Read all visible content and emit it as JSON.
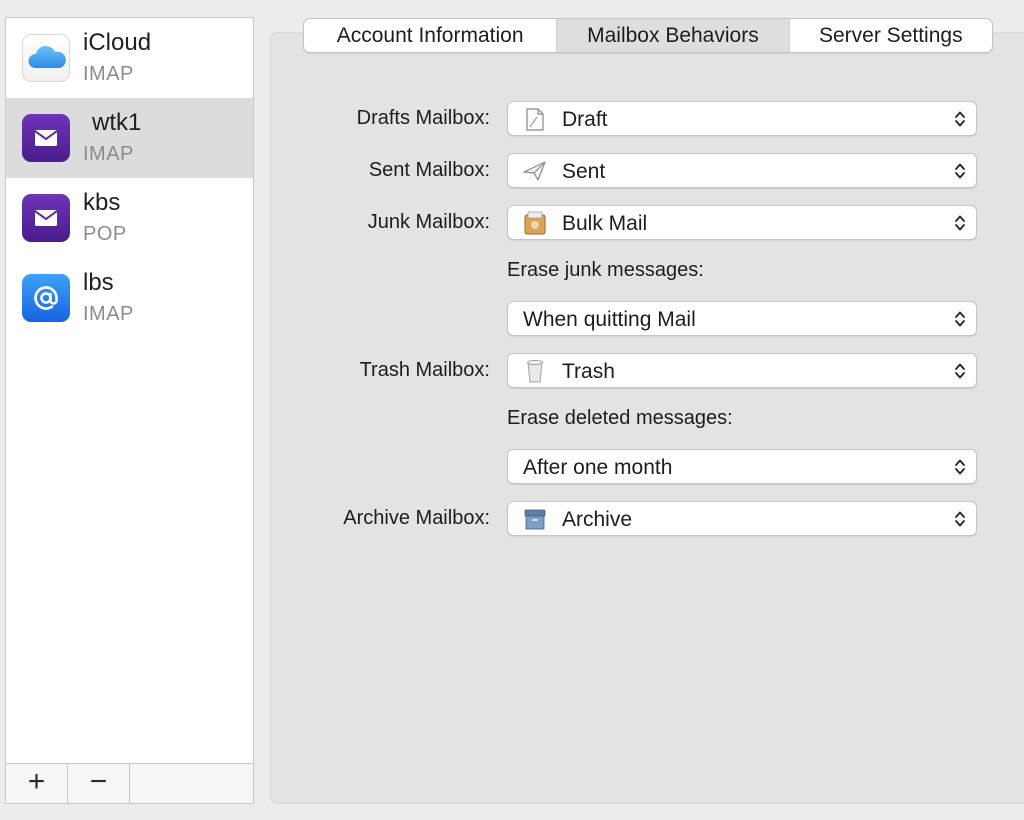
{
  "sidebar": {
    "accounts": [
      {
        "name": "iCloud",
        "type": "IMAP",
        "icon": "icloud-icon"
      },
      {
        "name": "wtk1",
        "type": "IMAP",
        "icon": "envelope-icon"
      },
      {
        "name": "kbs",
        "type": "POP",
        "icon": "envelope-icon"
      },
      {
        "name": "lbs",
        "type": "IMAP",
        "icon": "at-sign-icon"
      }
    ],
    "selected_index": 1,
    "footer": {
      "add": "+",
      "remove": "−"
    }
  },
  "tabs": [
    {
      "label": "Account Information",
      "active": false
    },
    {
      "label": "Mailbox Behaviors",
      "active": true
    },
    {
      "label": "Server Settings",
      "active": false
    }
  ],
  "form": {
    "drafts": {
      "label": "Drafts Mailbox:",
      "value": "Draft",
      "icon": "draft-document-icon"
    },
    "sent": {
      "label": "Sent Mailbox:",
      "value": "Sent",
      "icon": "paper-plane-icon"
    },
    "junk": {
      "label": "Junk Mailbox:",
      "value": "Bulk Mail",
      "icon": "junk-box-icon"
    },
    "erase_junk": {
      "label": "Erase junk messages:",
      "value": "When quitting Mail"
    },
    "trash": {
      "label": "Trash Mailbox:",
      "value": "Trash",
      "icon": "trash-can-icon"
    },
    "erase_deleted": {
      "label": "Erase deleted messages:",
      "value": "After one month"
    },
    "archive": {
      "label": "Archive Mailbox:",
      "value": "Archive",
      "icon": "archive-box-icon"
    }
  },
  "colors": {
    "selection": "#dcdcdc",
    "envelope_purple": "#5a24a3",
    "at_blue": "#2a86ee",
    "panel": "#e3e3e3"
  }
}
